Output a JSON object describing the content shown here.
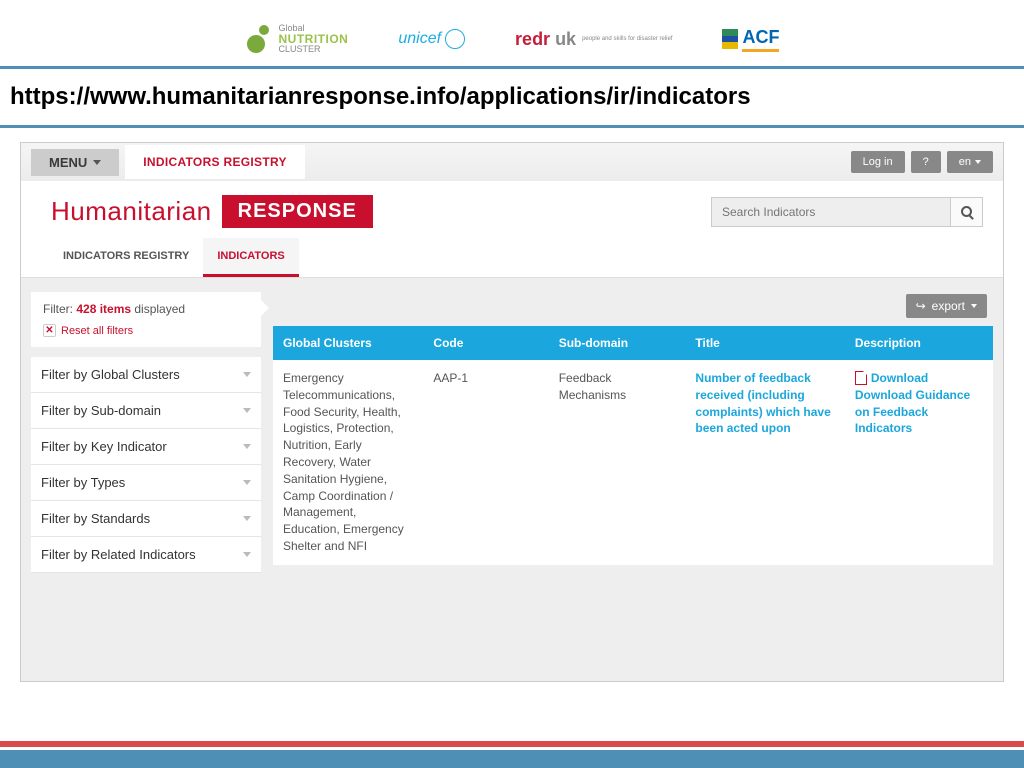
{
  "logos": {
    "gnc": {
      "line1": "Global",
      "line2": "NUTRITION",
      "line3": "CLUSTER"
    },
    "unicef": "unicef",
    "redr_main_l": "redr",
    "redr_main_r": " uk",
    "redr_sub": "people and skills for disaster relief",
    "acf": "ACF"
  },
  "url": "https://www.humanitarianresponse.info/applications/ir/indicators",
  "topbar": {
    "menu": "MENU",
    "tab": "INDICATORS REGISTRY",
    "login": "Log in",
    "help": "?",
    "lang": "en"
  },
  "brand": {
    "left": "Humanitarian",
    "right": "RESPONSE"
  },
  "search": {
    "placeholder": "Search Indicators"
  },
  "subtabs": {
    "a": "INDICATORS REGISTRY",
    "b": "INDICATORS"
  },
  "filter": {
    "prefix": "Filter: ",
    "count": "428 items",
    "suffix": " displayed",
    "reset": "Reset all filters",
    "groups": [
      "Filter by Global Clusters",
      "Filter by Sub-domain",
      "Filter by Key Indicator",
      "Filter by Types",
      "Filter by Standards",
      "Filter by Related Indicators"
    ]
  },
  "export": "export",
  "table": {
    "headers": [
      "Global Clusters",
      "Code",
      "Sub-domain",
      "Title",
      "Description"
    ],
    "row": {
      "clusters": "Emergency Telecommunications, Food Security, Health, Logistics, Protection, Nutrition, Early Recovery, Water Sanitation Hygiene, Camp Coordination / Management, Education, Emergency Shelter and NFI",
      "code": "AAP-1",
      "subdomain": "Feedback Mechanisms",
      "title": "Number of feedback received (including complaints) which have been acted upon",
      "desc_dl": "Download",
      "desc_rest": "Download Guidance on Feedback Indicators"
    }
  }
}
